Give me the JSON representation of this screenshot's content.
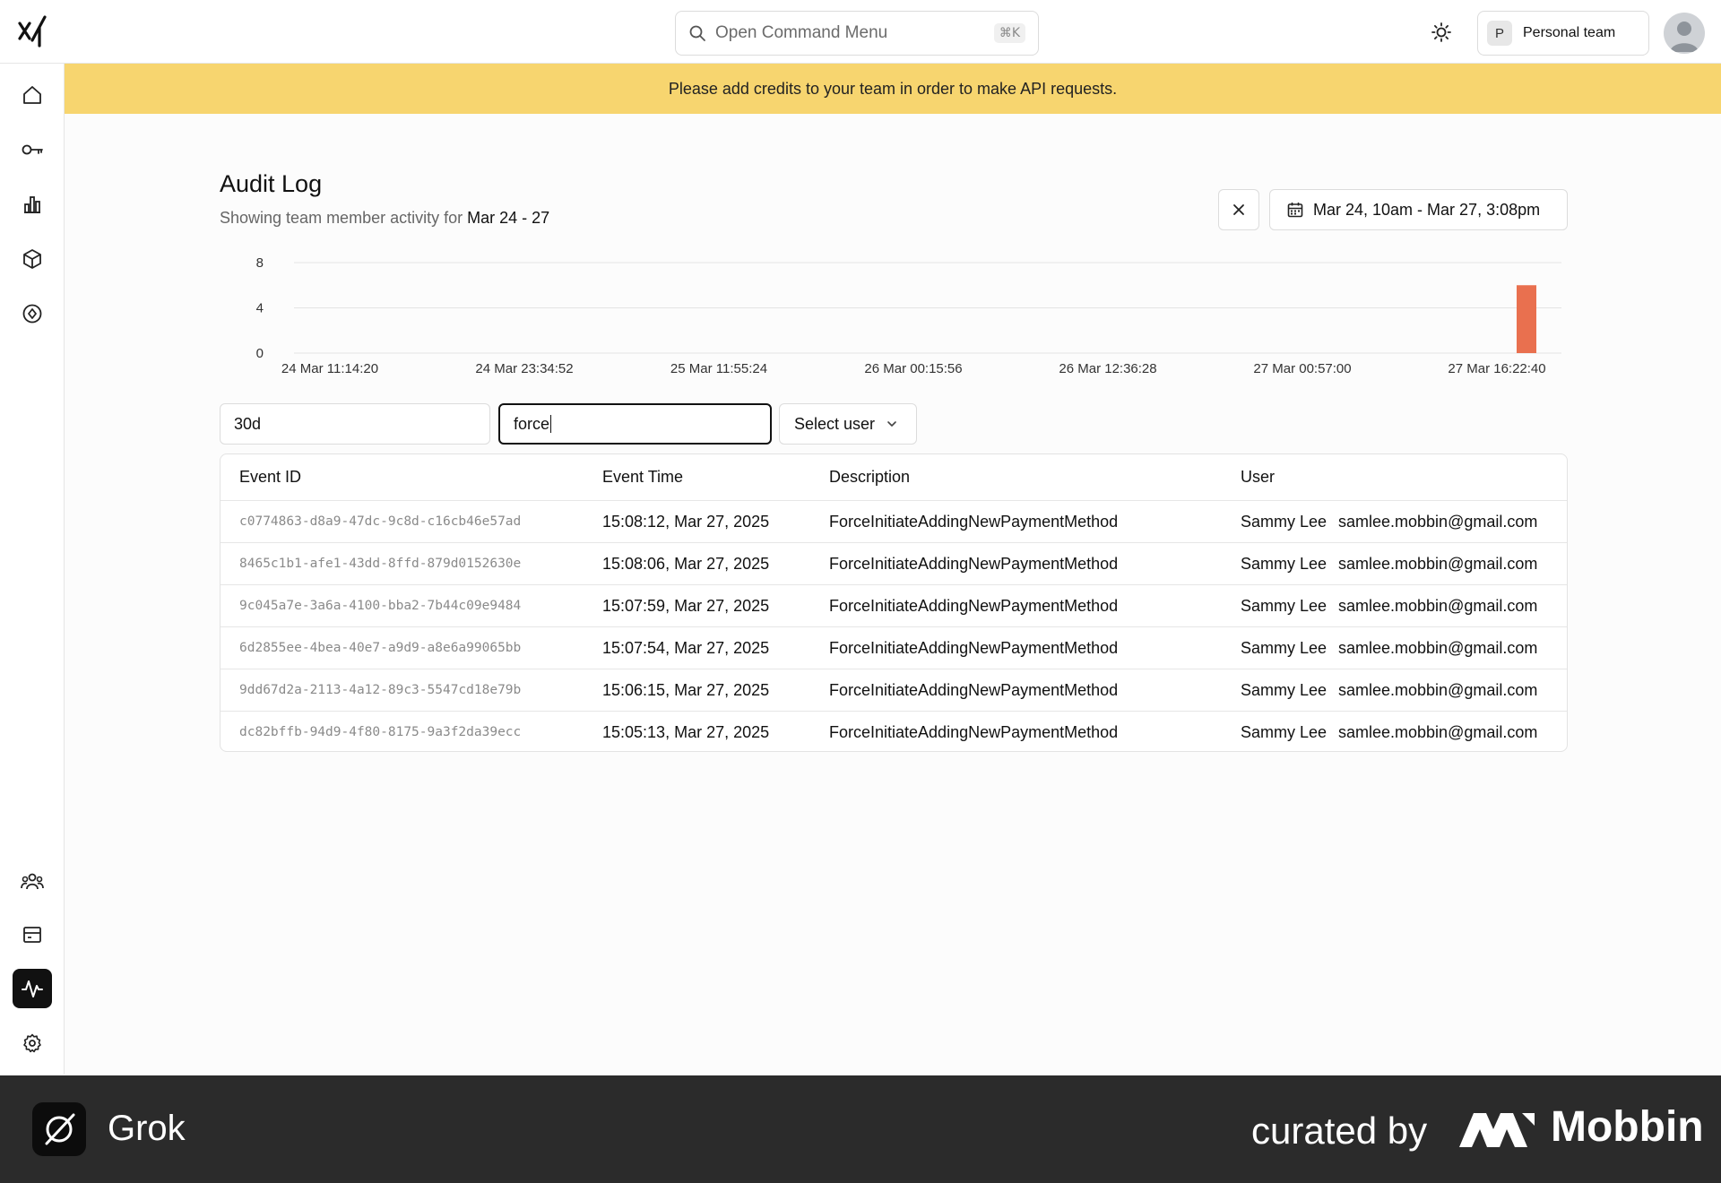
{
  "header": {
    "command_placeholder": "Open Command Menu",
    "command_shortcut": "⌘K",
    "team_initial": "P",
    "team_name": "Personal team"
  },
  "sidebar": {
    "icons": [
      "home-icon",
      "key-icon",
      "bar-chart-icon",
      "cube-icon",
      "compass-icon",
      "team-icon",
      "billing-card-icon",
      "activity-icon",
      "settings-icon"
    ],
    "active": "activity-icon"
  },
  "banner": {
    "text": "Please add credits to your team in order to make API requests."
  },
  "page": {
    "title": "Audit Log",
    "subtitle_prefix": "Showing team member activity for",
    "subtitle_range": "Mar 24 - 27",
    "date_range": "Mar 24, 10am - Mar 27, 3:08pm"
  },
  "chart_data": {
    "type": "bar",
    "y_ticks": [
      "8",
      "4",
      "0"
    ],
    "ylim": [
      0,
      8
    ],
    "x_ticks": [
      "24 Mar 11:14:20",
      "24 Mar 23:34:52",
      "25 Mar 11:55:24",
      "26 Mar 00:15:56",
      "26 Mar 12:36:28",
      "27 Mar 00:57:00",
      "27 Mar 16:22:40"
    ],
    "bars": [
      {
        "x": "27 Mar 15:08",
        "value": 6
      }
    ],
    "bar_color": "#e9704f",
    "grid": true
  },
  "filters": {
    "period_value": "30d",
    "search_value": "force",
    "user_select_label": "Select user"
  },
  "table": {
    "columns": [
      "Event ID",
      "Event Time",
      "Description",
      "User"
    ],
    "rows": [
      {
        "id": "c0774863-d8a9-47dc-9c8d-c16cb46e57ad",
        "time": "15:08:12, Mar 27, 2025",
        "description": "ForceInitiateAddingNewPaymentMethod",
        "user": "Sammy Lee",
        "email": "samlee.mobbin@gmail.com"
      },
      {
        "id": "8465c1b1-afe1-43dd-8ffd-879d0152630e",
        "time": "15:08:06, Mar 27, 2025",
        "description": "ForceInitiateAddingNewPaymentMethod",
        "user": "Sammy Lee",
        "email": "samlee.mobbin@gmail.com"
      },
      {
        "id": "9c045a7e-3a6a-4100-bba2-7b44c09e9484",
        "time": "15:07:59, Mar 27, 2025",
        "description": "ForceInitiateAddingNewPaymentMethod",
        "user": "Sammy Lee",
        "email": "samlee.mobbin@gmail.com"
      },
      {
        "id": "6d2855ee-4bea-40e7-a9d9-a8e6a99065bb",
        "time": "15:07:54, Mar 27, 2025",
        "description": "ForceInitiateAddingNewPaymentMethod",
        "user": "Sammy Lee",
        "email": "samlee.mobbin@gmail.com"
      },
      {
        "id": "9dd67d2a-2113-4a12-89c3-5547cd18e79b",
        "time": "15:06:15, Mar 27, 2025",
        "description": "ForceInitiateAddingNewPaymentMethod",
        "user": "Sammy Lee",
        "email": "samlee.mobbin@gmail.com"
      },
      {
        "id": "dc82bffb-94d9-4f80-8175-9a3f2da39ecc",
        "time": "15:05:13, Mar 27, 2025",
        "description": "ForceInitiateAddingNewPaymentMethod",
        "user": "Sammy Lee",
        "email": "samlee.mobbin@gmail.com"
      }
    ]
  },
  "footer": {
    "app_name": "Grok",
    "curated_text": "curated by",
    "brand": "Mobbin"
  }
}
